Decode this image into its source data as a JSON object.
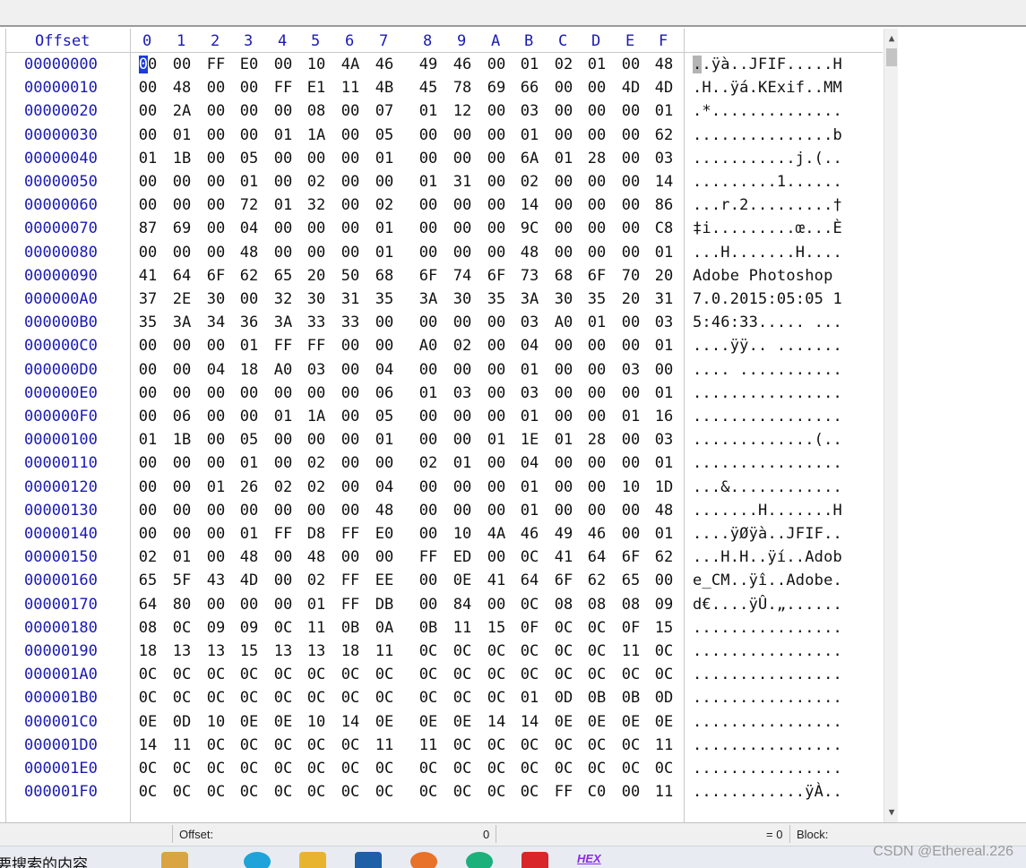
{
  "header": {
    "offset_label": "Offset",
    "columns": [
      "0",
      "1",
      "2",
      "3",
      "4",
      "5",
      "6",
      "7",
      "8",
      "9",
      "A",
      "B",
      "C",
      "D",
      "E",
      "F"
    ]
  },
  "rows": [
    {
      "offset": "00000000",
      "bytes": [
        "00",
        "00",
        "FF",
        "E0",
        "00",
        "10",
        "4A",
        "46",
        "49",
        "46",
        "00",
        "01",
        "02",
        "01",
        "00",
        "48"
      ],
      "ascii": "..ÿà..JFIF.....H"
    },
    {
      "offset": "00000010",
      "bytes": [
        "00",
        "48",
        "00",
        "00",
        "FF",
        "E1",
        "11",
        "4B",
        "45",
        "78",
        "69",
        "66",
        "00",
        "00",
        "4D",
        "4D"
      ],
      "ascii": ".H..ÿá.KExif..MM"
    },
    {
      "offset": "00000020",
      "bytes": [
        "00",
        "2A",
        "00",
        "00",
        "00",
        "08",
        "00",
        "07",
        "01",
        "12",
        "00",
        "03",
        "00",
        "00",
        "00",
        "01"
      ],
      "ascii": ".*.............."
    },
    {
      "offset": "00000030",
      "bytes": [
        "00",
        "01",
        "00",
        "00",
        "01",
        "1A",
        "00",
        "05",
        "00",
        "00",
        "00",
        "01",
        "00",
        "00",
        "00",
        "62"
      ],
      "ascii": "...............b"
    },
    {
      "offset": "00000040",
      "bytes": [
        "01",
        "1B",
        "00",
        "05",
        "00",
        "00",
        "00",
        "01",
        "00",
        "00",
        "00",
        "6A",
        "01",
        "28",
        "00",
        "03"
      ],
      "ascii": "...........j.(.."
    },
    {
      "offset": "00000050",
      "bytes": [
        "00",
        "00",
        "00",
        "01",
        "00",
        "02",
        "00",
        "00",
        "01",
        "31",
        "00",
        "02",
        "00",
        "00",
        "00",
        "14"
      ],
      "ascii": ".........1......"
    },
    {
      "offset": "00000060",
      "bytes": [
        "00",
        "00",
        "00",
        "72",
        "01",
        "32",
        "00",
        "02",
        "00",
        "00",
        "00",
        "14",
        "00",
        "00",
        "00",
        "86"
      ],
      "ascii": "...r.2.........†"
    },
    {
      "offset": "00000070",
      "bytes": [
        "87",
        "69",
        "00",
        "04",
        "00",
        "00",
        "00",
        "01",
        "00",
        "00",
        "00",
        "9C",
        "00",
        "00",
        "00",
        "C8"
      ],
      "ascii": "‡i.........œ...È"
    },
    {
      "offset": "00000080",
      "bytes": [
        "00",
        "00",
        "00",
        "48",
        "00",
        "00",
        "00",
        "01",
        "00",
        "00",
        "00",
        "48",
        "00",
        "00",
        "00",
        "01"
      ],
      "ascii": "...H.......H...."
    },
    {
      "offset": "00000090",
      "bytes": [
        "41",
        "64",
        "6F",
        "62",
        "65",
        "20",
        "50",
        "68",
        "6F",
        "74",
        "6F",
        "73",
        "68",
        "6F",
        "70",
        "20"
      ],
      "ascii": "Adobe Photoshop "
    },
    {
      "offset": "000000A0",
      "bytes": [
        "37",
        "2E",
        "30",
        "00",
        "32",
        "30",
        "31",
        "35",
        "3A",
        "30",
        "35",
        "3A",
        "30",
        "35",
        "20",
        "31"
      ],
      "ascii": "7.0.2015:05:05 1"
    },
    {
      "offset": "000000B0",
      "bytes": [
        "35",
        "3A",
        "34",
        "36",
        "3A",
        "33",
        "33",
        "00",
        "00",
        "00",
        "00",
        "03",
        "A0",
        "01",
        "00",
        "03"
      ],
      "ascii": "5:46:33..... ..."
    },
    {
      "offset": "000000C0",
      "bytes": [
        "00",
        "00",
        "00",
        "01",
        "FF",
        "FF",
        "00",
        "00",
        "A0",
        "02",
        "00",
        "04",
        "00",
        "00",
        "00",
        "01"
      ],
      "ascii": "....ÿÿ.. ......."
    },
    {
      "offset": "000000D0",
      "bytes": [
        "00",
        "00",
        "04",
        "18",
        "A0",
        "03",
        "00",
        "04",
        "00",
        "00",
        "00",
        "01",
        "00",
        "00",
        "03",
        "00"
      ],
      "ascii": ".... ..........."
    },
    {
      "offset": "000000E0",
      "bytes": [
        "00",
        "00",
        "00",
        "00",
        "00",
        "00",
        "00",
        "06",
        "01",
        "03",
        "00",
        "03",
        "00",
        "00",
        "00",
        "01"
      ],
      "ascii": "................"
    },
    {
      "offset": "000000F0",
      "bytes": [
        "00",
        "06",
        "00",
        "00",
        "01",
        "1A",
        "00",
        "05",
        "00",
        "00",
        "00",
        "01",
        "00",
        "00",
        "01",
        "16"
      ],
      "ascii": "................"
    },
    {
      "offset": "00000100",
      "bytes": [
        "01",
        "1B",
        "00",
        "05",
        "00",
        "00",
        "00",
        "01",
        "00",
        "00",
        "01",
        "1E",
        "01",
        "28",
        "00",
        "03"
      ],
      "ascii": ".............(.."
    },
    {
      "offset": "00000110",
      "bytes": [
        "00",
        "00",
        "00",
        "01",
        "00",
        "02",
        "00",
        "00",
        "02",
        "01",
        "00",
        "04",
        "00",
        "00",
        "00",
        "01"
      ],
      "ascii": "................"
    },
    {
      "offset": "00000120",
      "bytes": [
        "00",
        "00",
        "01",
        "26",
        "02",
        "02",
        "00",
        "04",
        "00",
        "00",
        "00",
        "01",
        "00",
        "00",
        "10",
        "1D"
      ],
      "ascii": "...&............"
    },
    {
      "offset": "00000130",
      "bytes": [
        "00",
        "00",
        "00",
        "00",
        "00",
        "00",
        "00",
        "48",
        "00",
        "00",
        "00",
        "01",
        "00",
        "00",
        "00",
        "48"
      ],
      "ascii": ".......H.......H"
    },
    {
      "offset": "00000140",
      "bytes": [
        "00",
        "00",
        "00",
        "01",
        "FF",
        "D8",
        "FF",
        "E0",
        "00",
        "10",
        "4A",
        "46",
        "49",
        "46",
        "00",
        "01"
      ],
      "ascii": "....ÿØÿà..JFIF.."
    },
    {
      "offset": "00000150",
      "bytes": [
        "02",
        "01",
        "00",
        "48",
        "00",
        "48",
        "00",
        "00",
        "FF",
        "ED",
        "00",
        "0C",
        "41",
        "64",
        "6F",
        "62"
      ],
      "ascii": "...H.H..ÿí..Adob"
    },
    {
      "offset": "00000160",
      "bytes": [
        "65",
        "5F",
        "43",
        "4D",
        "00",
        "02",
        "FF",
        "EE",
        "00",
        "0E",
        "41",
        "64",
        "6F",
        "62",
        "65",
        "00"
      ],
      "ascii": "e_CM..ÿî..Adobe."
    },
    {
      "offset": "00000170",
      "bytes": [
        "64",
        "80",
        "00",
        "00",
        "00",
        "01",
        "FF",
        "DB",
        "00",
        "84",
        "00",
        "0C",
        "08",
        "08",
        "08",
        "09"
      ],
      "ascii": "d€....ÿÛ.„......"
    },
    {
      "offset": "00000180",
      "bytes": [
        "08",
        "0C",
        "09",
        "09",
        "0C",
        "11",
        "0B",
        "0A",
        "0B",
        "11",
        "15",
        "0F",
        "0C",
        "0C",
        "0F",
        "15"
      ],
      "ascii": "................"
    },
    {
      "offset": "00000190",
      "bytes": [
        "18",
        "13",
        "13",
        "15",
        "13",
        "13",
        "18",
        "11",
        "0C",
        "0C",
        "0C",
        "0C",
        "0C",
        "0C",
        "11",
        "0C"
      ],
      "ascii": "................"
    },
    {
      "offset": "000001A0",
      "bytes": [
        "0C",
        "0C",
        "0C",
        "0C",
        "0C",
        "0C",
        "0C",
        "0C",
        "0C",
        "0C",
        "0C",
        "0C",
        "0C",
        "0C",
        "0C",
        "0C"
      ],
      "ascii": "................"
    },
    {
      "offset": "000001B0",
      "bytes": [
        "0C",
        "0C",
        "0C",
        "0C",
        "0C",
        "0C",
        "0C",
        "0C",
        "0C",
        "0C",
        "0C",
        "01",
        "0D",
        "0B",
        "0B",
        "0D"
      ],
      "ascii": "................"
    },
    {
      "offset": "000001C0",
      "bytes": [
        "0E",
        "0D",
        "10",
        "0E",
        "0E",
        "10",
        "14",
        "0E",
        "0E",
        "0E",
        "14",
        "14",
        "0E",
        "0E",
        "0E",
        "0E"
      ],
      "ascii": "................"
    },
    {
      "offset": "000001D0",
      "bytes": [
        "14",
        "11",
        "0C",
        "0C",
        "0C",
        "0C",
        "0C",
        "11",
        "11",
        "0C",
        "0C",
        "0C",
        "0C",
        "0C",
        "0C",
        "11"
      ],
      "ascii": "................"
    },
    {
      "offset": "000001E0",
      "bytes": [
        "0C",
        "0C",
        "0C",
        "0C",
        "0C",
        "0C",
        "0C",
        "0C",
        "0C",
        "0C",
        "0C",
        "0C",
        "0C",
        "0C",
        "0C",
        "0C"
      ],
      "ascii": "................"
    },
    {
      "offset": "000001F0",
      "bytes": [
        "0C",
        "0C",
        "0C",
        "0C",
        "0C",
        "0C",
        "0C",
        "0C",
        "0C",
        "0C",
        "0C",
        "0C",
        "FF",
        "C0",
        "00",
        "11"
      ],
      "ascii": "............ÿÀ.."
    }
  ],
  "statusbar": {
    "offset_label": "Offset:",
    "offset_value": "0",
    "selection_value": "= 0",
    "block_label": "Block:"
  },
  "taskbar": {
    "search_text": "要搜索的内容",
    "icons": [
      {
        "name": "file-explorer-folder-icon",
        "color": "#d9a441"
      },
      {
        "name": "edge-browser-icon",
        "color": "#1fa3d8"
      },
      {
        "name": "folder-icon",
        "color": "#e8b430"
      },
      {
        "name": "mail-icon",
        "color": "#1f5fa8"
      },
      {
        "name": "firefox-icon",
        "color": "#e8722a"
      },
      {
        "name": "app-green-icon",
        "color": "#1cb07a"
      },
      {
        "name": "app-red-icon",
        "color": "#d8262a"
      },
      {
        "name": "hex-editor-icon",
        "color": "#8a2be2"
      }
    ],
    "hex_icon_text": "HEX"
  },
  "watermark": "CSDN @Ethereal.226"
}
